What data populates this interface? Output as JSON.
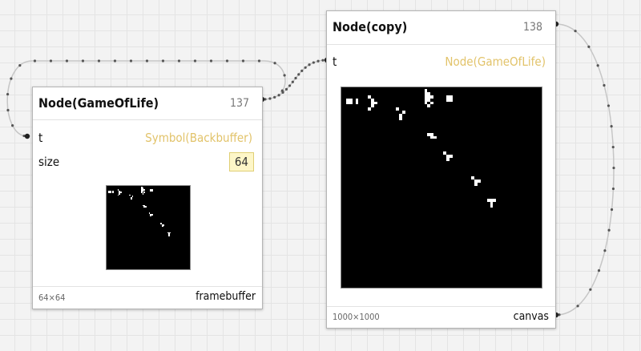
{
  "colors": {
    "symbol_value": "#e2c36a",
    "wire": "#c6c6c6",
    "wire_dot": "#555555",
    "number_box_bg": "#fdf6c8"
  },
  "nodes": {
    "gameoflife": {
      "title": "Node(GameOfLife)",
      "id": "137",
      "inputs": [
        {
          "label": "t",
          "value": "Symbol(Backbuffer)"
        },
        {
          "label": "size",
          "value": "64"
        }
      ],
      "dims": "64×64",
      "output_label": "framebuffer"
    },
    "copy": {
      "title": "Node(copy)",
      "id": "138",
      "inputs": [
        {
          "label": "t",
          "value": "Node(GameOfLife)"
        }
      ],
      "dims": "1000×1000",
      "output_label": "canvas"
    }
  }
}
